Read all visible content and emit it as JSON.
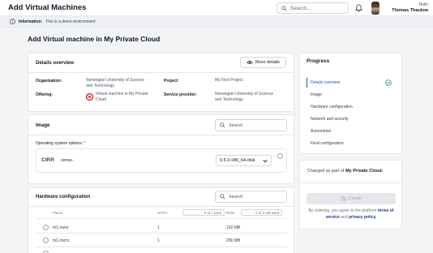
{
  "header": {
    "title": "Add Virtual Machines",
    "search_placeholder": "Search...",
    "user_greeting": "Hello",
    "user_name": "Thomas Thaulow"
  },
  "info_bar": {
    "label": "Information:",
    "message": "This is a demo environment"
  },
  "page_title": "Add Virtual machine in My Private Cloud",
  "details": {
    "title": "Details overview",
    "more_button": "More details",
    "organization_label": "Organization:",
    "organization_line1": "Norwegian University of Science",
    "organization_line2": "and Technology",
    "project_label": "Project:",
    "project_value": "My First Project",
    "offering_label": "Offering:",
    "offering_line1": "Virtual machine in My Private",
    "offering_line2": "Cloud",
    "provider_label": "Service provider:",
    "provider_line1": "Norwegian University of Science",
    "provider_line2": "and Technology"
  },
  "image": {
    "title": "Image",
    "search_placeholder": "Search",
    "os_label": "Operating system options:",
    "required_mark": "*",
    "os_logo_text": "CIRR",
    "os_name": "cirros-",
    "version_selected": "0.6.3-x86_64-disk"
  },
  "hardware": {
    "title": "Hardware configuration",
    "search_placeholder": "Search",
    "columns": {
      "flavor": "Flavor",
      "vcpu": "vCPU",
      "ram": "RAM"
    },
    "vcpu_usage": "0 of 1 used",
    "ram_usage": "0 of 2 GB used",
    "rows": [
      {
        "flavor": "m1.nano",
        "vcpu": "1",
        "ram": "192 MB"
      },
      {
        "flavor": "m1.micro",
        "vcpu": "1",
        "ram": "256 MB"
      }
    ]
  },
  "progress": {
    "title": "Progress",
    "steps": [
      "Details overview",
      "Image",
      "Hardware configuration",
      "Network and security",
      "Automation",
      "Final configuration"
    ],
    "charged_prefix": "Charged as part of",
    "charged_bold": "My Private Cloud.",
    "create_button": "Create",
    "terms_prefix": "By ordering, you agree to the platform",
    "terms_link1": "terms of service",
    "terms_and": "and",
    "terms_link2": "privacy policy."
  },
  "colors": {
    "accent": "#1d4ed8",
    "success": "#16a34a",
    "os_logo": "#166534"
  }
}
